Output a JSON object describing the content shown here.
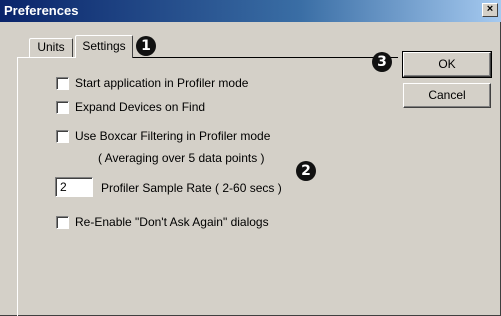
{
  "window": {
    "title": "Preferences",
    "close_glyph": "×"
  },
  "tabs": [
    {
      "label": "Units",
      "active": false
    },
    {
      "label": "Settings",
      "active": true
    }
  ],
  "options": [
    {
      "label": "Start application in Profiler mode",
      "checked": false
    },
    {
      "label": "Expand Devices on Find",
      "checked": false
    },
    {
      "label": "Use Boxcar Filtering in Profiler mode",
      "checked": false
    },
    {
      "label": "Re-Enable \"Don't Ask Again\" dialogs",
      "checked": false
    }
  ],
  "boxcar_note": "( Averaging over 5 data points )",
  "sample_rate": {
    "value": "2",
    "label": "Profiler Sample Rate ( 2-60 secs )"
  },
  "buttons": {
    "ok": "OK",
    "cancel": "Cancel"
  },
  "callouts": {
    "one": "1",
    "two": "2",
    "three": "3"
  }
}
